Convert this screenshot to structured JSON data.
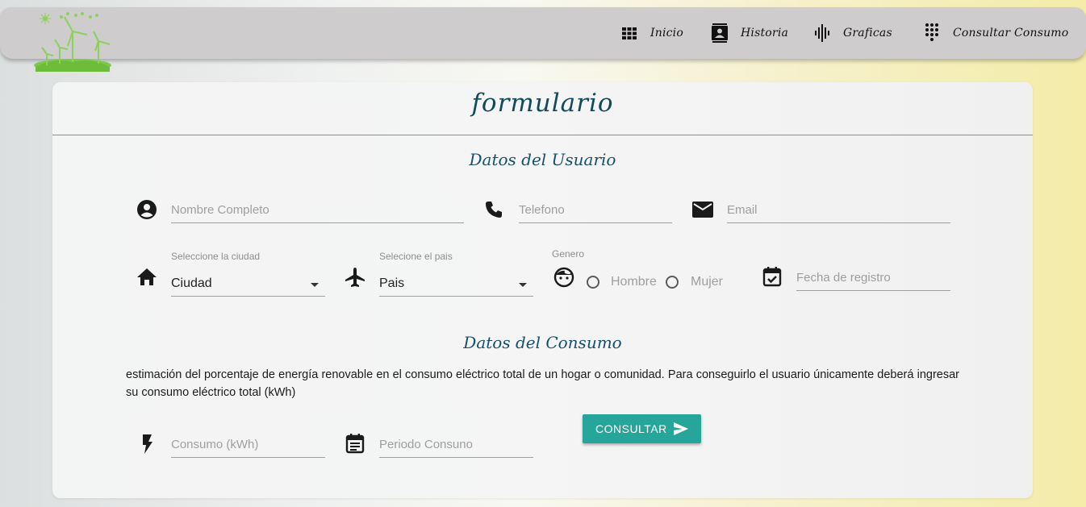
{
  "nav": {
    "items": [
      {
        "label": "Inicio",
        "icon": "grid-icon"
      },
      {
        "label": "Historia",
        "icon": "contact-book-icon"
      },
      {
        "label": "Graficas",
        "icon": "sound-wave-icon"
      },
      {
        "label": "Consultar Consumo",
        "icon": "dialpad-icon"
      }
    ]
  },
  "form": {
    "title": "formulario",
    "user_section_title": "Datos del Usuario",
    "nombre_placeholder": "Nombre Completo",
    "telefono_placeholder": "Telefono",
    "email_placeholder": "Email",
    "ciudad_label": "Seleccione la ciudad",
    "ciudad_value": "Ciudad",
    "pais_label": "Selecione el pais",
    "pais_value": "Pais",
    "genero_label": "Genero",
    "genero_options": [
      "Hombre",
      "Mujer"
    ],
    "fecha_placeholder": "Fecha de registro",
    "consumo_section_title": "Datos del Consumo",
    "description": "estimación del porcentaje de energía renovable en el consumo eléctrico total de un hogar o comunidad. Para conseguirlo el usuario únicamente deberá ingresar su consumo eléctrico total (kWh)",
    "consumo_placeholder": "Consumo (kWh)",
    "periodo_placeholder": "Periodo Consuno",
    "submit_label": "CONSULTAR"
  },
  "colors": {
    "navbar": "#cecccc",
    "title": "#114a5a",
    "button": "#26a69a"
  }
}
